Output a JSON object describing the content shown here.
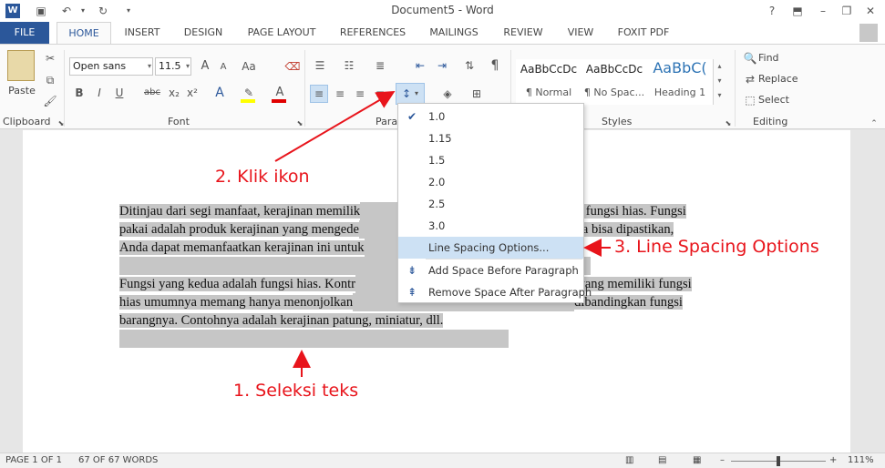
{
  "window": {
    "title": "Document5 - Word",
    "help": "?"
  },
  "tabs": [
    "FILE",
    "HOME",
    "INSERT",
    "DESIGN",
    "PAGE LAYOUT",
    "REFERENCES",
    "MAILINGS",
    "REVIEW",
    "VIEW",
    "FOXIT PDF"
  ],
  "ribbon": {
    "clipboard": {
      "paste": "Paste",
      "label": "Clipboard"
    },
    "font": {
      "family": "Open sans",
      "size": "11.5",
      "label": "Font",
      "bold": "B",
      "italic": "I",
      "underline": "U",
      "sub": "x₂",
      "sup": "x²",
      "grow": "A",
      "shrink": "A",
      "case": "Aa"
    },
    "paragraph": {
      "label": "Paragr"
    },
    "styles": {
      "label": "Styles",
      "items": [
        {
          "preview": "AaBbCcDc",
          "name": "¶ Normal"
        },
        {
          "preview": "AaBbCcDc",
          "name": "¶ No Spac..."
        },
        {
          "preview": "AaBbC(",
          "name": "Heading 1"
        }
      ]
    },
    "editing": {
      "find": "Find",
      "replace": "Replace",
      "select": "Select",
      "label": "Editing"
    }
  },
  "document": {
    "para1": [
      "Ditinjau dari segi manfaat, kerajinan memilik",
      "ai dan fungsi hias. Fungsi",
      "pakai adalah produk kerajinan yang mengede",
      "hingga bisa dipastikan,",
      "Anda dapat memanfaatkan kerajinan ini untuk"
    ],
    "para2": [
      "Fungsi yang kedua adalah fungsi hias. Kontr",
      "jinan yang memiliki fungsi",
      "hias umumnya memang hanya menonjolkan",
      "dibandingkan fungsi",
      "barangnya. Contohnya adalah kerajinan patung, miniatur, dll."
    ]
  },
  "menu": {
    "items": [
      "1.0",
      "1.15",
      "1.5",
      "2.0",
      "2.5",
      "3.0"
    ],
    "options": "Line Spacing Options...",
    "add_before": "Add Space Before Paragraph",
    "remove_after": "Remove Space After Paragraph"
  },
  "annotations": {
    "step1": "1. Seleksi teks",
    "step2": "2. Klik ikon",
    "step3": "3. Line Spacing Options",
    "color": "#e8141b"
  },
  "status": {
    "page": "PAGE 1 OF 1",
    "words": "67 OF 67 WORDS",
    "zoom": "111%"
  }
}
